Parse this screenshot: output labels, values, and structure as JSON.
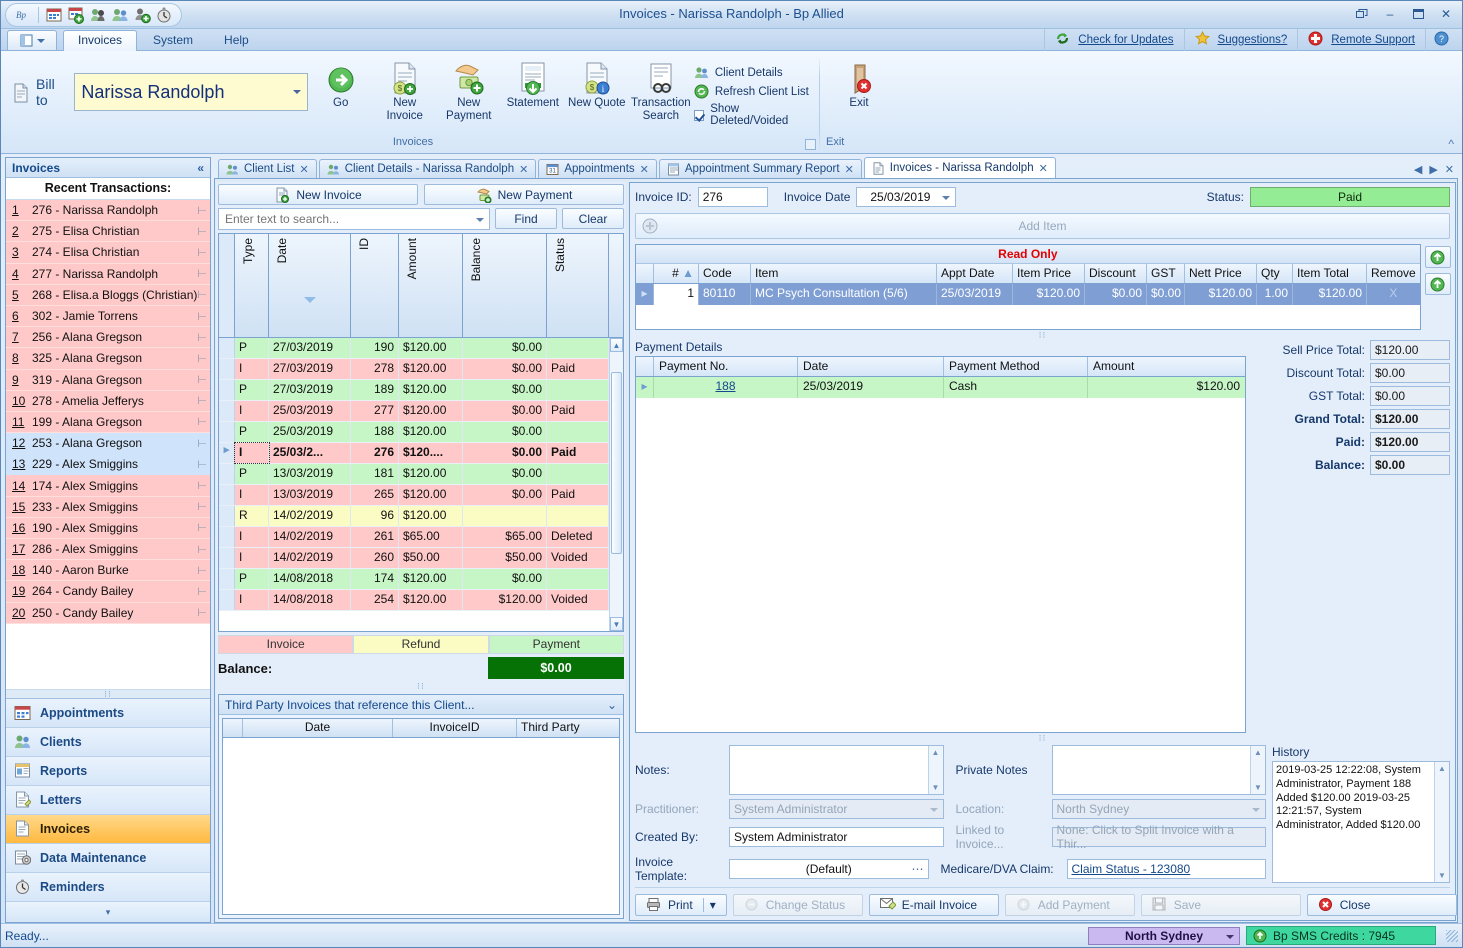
{
  "window": {
    "title": "Invoices - Narissa Randolph - Bp Allied",
    "restore_label": "❐",
    "minimize_label": "–",
    "maximize_label": "❐",
    "close_label": "✕"
  },
  "quick_access": {
    "logo_text": "Bp",
    "icons": [
      "calendar-icon",
      "calendar-add-icon",
      "client-search-icon",
      "clients-icon",
      "client-add-icon",
      "reminders-icon"
    ]
  },
  "ribbon_tabs": [
    {
      "label": "Invoices",
      "active": true
    },
    {
      "label": "System",
      "active": false
    },
    {
      "label": "Help",
      "active": false
    }
  ],
  "ribbon_links": [
    {
      "label": "Check for Updates",
      "icon": "refresh-icon"
    },
    {
      "label": "Suggestions?",
      "icon": "star-icon"
    },
    {
      "label": "Remote Support",
      "icon": "support-icon"
    },
    {
      "label": "",
      "icon": "help-icon"
    }
  ],
  "ribbon": {
    "group_title": "Invoices",
    "exit_group_title": "Exit",
    "bill_to_label": "Bill to",
    "client_name": "Narissa Randolph",
    "buttons": [
      {
        "label": "Go",
        "icon": "go-arrow-icon"
      },
      {
        "label": "New Invoice",
        "icon": "new-invoice-icon"
      },
      {
        "label": "New Payment",
        "icon": "new-payment-icon"
      },
      {
        "label": "Statement",
        "icon": "statement-icon"
      },
      {
        "label": "New Quote",
        "icon": "new-quote-icon"
      },
      {
        "label": "Transaction Search",
        "icon": "transaction-search-icon"
      }
    ],
    "small_buttons": [
      {
        "label": "Client Details",
        "icon": "clients-icon",
        "type": "link"
      },
      {
        "label": "Refresh Client List",
        "icon": "refresh-icon",
        "type": "link"
      },
      {
        "label": "Show Deleted/Voided",
        "icon": "checkbox",
        "type": "checkbox",
        "checked": true
      }
    ],
    "exit_label": "Exit"
  },
  "nav": {
    "header": "Invoices",
    "collapse_icon": "chevron-double-left-icon",
    "recent_title": "Recent Transactions:",
    "recent": [
      {
        "num": "1",
        "label": "276 - Narissa Randolph",
        "selected": false
      },
      {
        "num": "2",
        "label": "275 - Elisa Christian",
        "selected": false
      },
      {
        "num": "3",
        "label": "274 - Elisa Christian",
        "selected": false
      },
      {
        "num": "4",
        "label": "277 - Narissa Randolph",
        "selected": false
      },
      {
        "num": "5",
        "label": "268 - Elisa.a Bloggs (Christian)",
        "selected": false
      },
      {
        "num": "6",
        "label": "302 - Jamie Torrens",
        "selected": false
      },
      {
        "num": "7",
        "label": "256 - Alana Gregson",
        "selected": false
      },
      {
        "num": "8",
        "label": "325 - Alana Gregson",
        "selected": false
      },
      {
        "num": "9",
        "label": "319 - Alana Gregson",
        "selected": false
      },
      {
        "num": "10",
        "label": "278 - Amelia Jefferys",
        "selected": false
      },
      {
        "num": "11",
        "label": "199 - Alana Gregson",
        "selected": false
      },
      {
        "num": "12",
        "label": "253 - Alana Gregson",
        "selected": true
      },
      {
        "num": "13",
        "label": "229 - Alex Smiggins",
        "selected": true
      },
      {
        "num": "14",
        "label": "174 - Alex Smiggins",
        "selected": false
      },
      {
        "num": "15",
        "label": "233 - Alex Smiggins",
        "selected": false
      },
      {
        "num": "16",
        "label": "190 - Alex Smiggins",
        "selected": false
      },
      {
        "num": "17",
        "label": "286 - Alex Smiggins",
        "selected": false
      },
      {
        "num": "18",
        "label": "140 - Aaron Burke",
        "selected": false
      },
      {
        "num": "19",
        "label": "264 - Candy Bailey",
        "selected": false
      },
      {
        "num": "20",
        "label": "250 - Candy Bailey",
        "selected": false
      }
    ],
    "buttons": [
      {
        "label": "Appointments",
        "icon": "calendar-icon",
        "active": false
      },
      {
        "label": "Clients",
        "icon": "clients-icon",
        "active": false
      },
      {
        "label": "Reports",
        "icon": "reports-icon",
        "active": false
      },
      {
        "label": "Letters",
        "icon": "letters-icon",
        "active": false
      },
      {
        "label": "Invoices",
        "icon": "invoices-icon",
        "active": true
      },
      {
        "label": "Data Maintenance",
        "icon": "data-maintenance-icon",
        "active": false
      },
      {
        "label": "Reminders",
        "icon": "reminders-icon",
        "active": false
      }
    ]
  },
  "doc_tabs": [
    {
      "label": "Client List",
      "icon": "clients-icon",
      "active": false
    },
    {
      "label": "Client Details - Narissa Randolph",
      "icon": "clients-icon",
      "active": false
    },
    {
      "label": "Appointments",
      "icon": "calendar-icon",
      "active": false
    },
    {
      "label": "Appointment Summary Report",
      "icon": "report-icon",
      "active": false
    },
    {
      "label": "Invoices - Narissa Randolph",
      "icon": "invoices-icon",
      "active": true
    }
  ],
  "left": {
    "new_invoice_label": "New Invoice",
    "new_payment_label": "New Payment",
    "search_placeholder": "Enter text to search...",
    "search_value": "",
    "find_label": "Find",
    "clear_label": "Clear",
    "columns": [
      "Type",
      "Date",
      "ID",
      "Amount",
      "Balance",
      "Status"
    ],
    "sorted_column": "Date",
    "rows": [
      {
        "type": "P",
        "date": "27/03/2019",
        "id": "190",
        "amount": "$120.00",
        "balance": "$0.00",
        "status": "",
        "kind": "pay",
        "current": false
      },
      {
        "type": "I",
        "date": "27/03/2019",
        "id": "278",
        "amount": "$120.00",
        "balance": "$0.00",
        "status": "Paid",
        "kind": "inv",
        "current": false
      },
      {
        "type": "P",
        "date": "27/03/2019",
        "id": "189",
        "amount": "$120.00",
        "balance": "$0.00",
        "status": "",
        "kind": "pay",
        "current": false
      },
      {
        "type": "I",
        "date": "25/03/2019",
        "id": "277",
        "amount": "$120.00",
        "balance": "$0.00",
        "status": "Paid",
        "kind": "inv",
        "current": false
      },
      {
        "type": "P",
        "date": "25/03/2019",
        "id": "188",
        "amount": "$120.00",
        "balance": "$0.00",
        "status": "",
        "kind": "pay",
        "current": false
      },
      {
        "type": "I",
        "date": "25/03/2...",
        "id": "276",
        "amount": "$120....",
        "balance": "$0.00",
        "status": "Paid",
        "kind": "inv",
        "current": true
      },
      {
        "type": "P",
        "date": "13/03/2019",
        "id": "181",
        "amount": "$120.00",
        "balance": "$0.00",
        "status": "",
        "kind": "pay",
        "current": false
      },
      {
        "type": "I",
        "date": "13/03/2019",
        "id": "265",
        "amount": "$120.00",
        "balance": "$0.00",
        "status": "Paid",
        "kind": "inv",
        "current": false
      },
      {
        "type": "R",
        "date": "14/02/2019",
        "id": "96",
        "amount": "$120.00",
        "balance": "",
        "status": "",
        "kind": "ref",
        "current": false
      },
      {
        "type": "I",
        "date": "14/02/2019",
        "id": "261",
        "amount": "$65.00",
        "balance": "$65.00",
        "status": "Deleted",
        "kind": "inv",
        "current": false
      },
      {
        "type": "I",
        "date": "14/02/2019",
        "id": "260",
        "amount": "$50.00",
        "balance": "$50.00",
        "status": "Voided",
        "kind": "inv",
        "current": false
      },
      {
        "type": "P",
        "date": "14/08/2018",
        "id": "174",
        "amount": "$120.00",
        "balance": "$0.00",
        "status": "",
        "kind": "pay",
        "current": false
      },
      {
        "type": "I",
        "date": "14/08/2018",
        "id": "254",
        "amount": "$120.00",
        "balance": "$120.00",
        "status": "Voided",
        "kind": "inv",
        "current": false
      }
    ],
    "legend": [
      {
        "label": "Invoice",
        "color": "#ffc9c9"
      },
      {
        "label": "Refund",
        "color": "#fbfbc4"
      },
      {
        "label": "Payment",
        "color": "#c6f5c6"
      }
    ],
    "balance_label": "Balance:",
    "balance_value": "$0.00",
    "third_party": {
      "title": "Third Party Invoices that reference this Client...",
      "expand_icon": "chevron-double-down-icon",
      "columns": [
        "Date",
        "InvoiceID",
        "Third Party"
      ],
      "rows": []
    }
  },
  "detail": {
    "invoice_id_label": "Invoice ID:",
    "invoice_id_value": "276",
    "invoice_date_label": "Invoice Date",
    "invoice_date_value": "25/03/2019",
    "status_label": "Status:",
    "status_value": "Paid",
    "status_color": "#94ed94",
    "add_item_label": "Add Item",
    "read_only_banner": "Read Only",
    "item_columns": [
      "#",
      "Code",
      "Item",
      "Appt Date",
      "Item Price",
      "Discount",
      "GST",
      "Nett Price",
      "Qty",
      "Item Total",
      "Remove"
    ],
    "items": [
      {
        "num": "1",
        "code": "80110",
        "item": "MC Psych Consultation (5/6)",
        "appt_date": "25/03/2019",
        "item_price": "$120.00",
        "discount": "$0.00",
        "gst": "$0.00",
        "nett_price": "$120.00",
        "qty": "1.00",
        "item_total": "$120.00",
        "remove": "X"
      }
    ],
    "payment_details_label": "Payment Details",
    "payment_columns": [
      "Payment No.",
      "Date",
      "Payment Method",
      "Amount"
    ],
    "payments": [
      {
        "no": "188",
        "date": "25/03/2019",
        "method": "Cash",
        "amount": "$120.00"
      }
    ],
    "totals": [
      {
        "label": "Sell Price Total:",
        "value": "$120.00",
        "bold": false
      },
      {
        "label": "Discount Total:",
        "value": "$0.00",
        "bold": false
      },
      {
        "label": "GST Total:",
        "value": "$0.00",
        "bold": false
      },
      {
        "label": "Grand Total:",
        "value": "$120.00",
        "bold": true
      },
      {
        "label": "Paid:",
        "value": "$120.00",
        "bold": true
      },
      {
        "label": "Balance:",
        "value": "$0.00",
        "bold": true
      }
    ],
    "notes_label": "Notes:",
    "notes_value": "",
    "private_notes_label": "Private Notes",
    "private_notes_value": "",
    "practitioner_label": "Practitioner:",
    "practitioner_value": "System Administrator",
    "location_label": "Location:",
    "location_value": "North Sydney",
    "created_by_label": "Created By:",
    "created_by_value": "System Administrator",
    "linked_label": "Linked to Invoice...",
    "linked_value": "None: Click to Split Invoice with a Thir...",
    "template_label": "Invoice Template:",
    "template_value": "(Default)",
    "template_browse": "⋯",
    "medicare_label": "Medicare/DVA Claim:",
    "medicare_value": "Claim Status - 123080",
    "history_label": "History",
    "history_text": "2019-03-25 12:22:08, System Administrator, Payment 188 Added $120.00\n2019-03-25 12:21:57, System Administrator, Added $120.00",
    "actions": [
      {
        "label": "Print",
        "icon": "printer-icon",
        "disabled": false,
        "split": true
      },
      {
        "label": "Change Status",
        "icon": "status-icon",
        "disabled": true,
        "split": false
      },
      {
        "label": "E-mail Invoice",
        "icon": "email-icon",
        "disabled": false,
        "split": false
      },
      {
        "label": "Add Payment",
        "icon": "payment-icon",
        "disabled": true,
        "split": false
      },
      {
        "label": "Save",
        "icon": "save-icon",
        "disabled": true,
        "split": false
      },
      {
        "label": "Close",
        "icon": "close-red-icon",
        "disabled": false,
        "split": false
      }
    ]
  },
  "statusbar": {
    "ready_text": "Ready...",
    "location": "North Sydney",
    "sms_credits": "Bp SMS Credits : 7945"
  }
}
